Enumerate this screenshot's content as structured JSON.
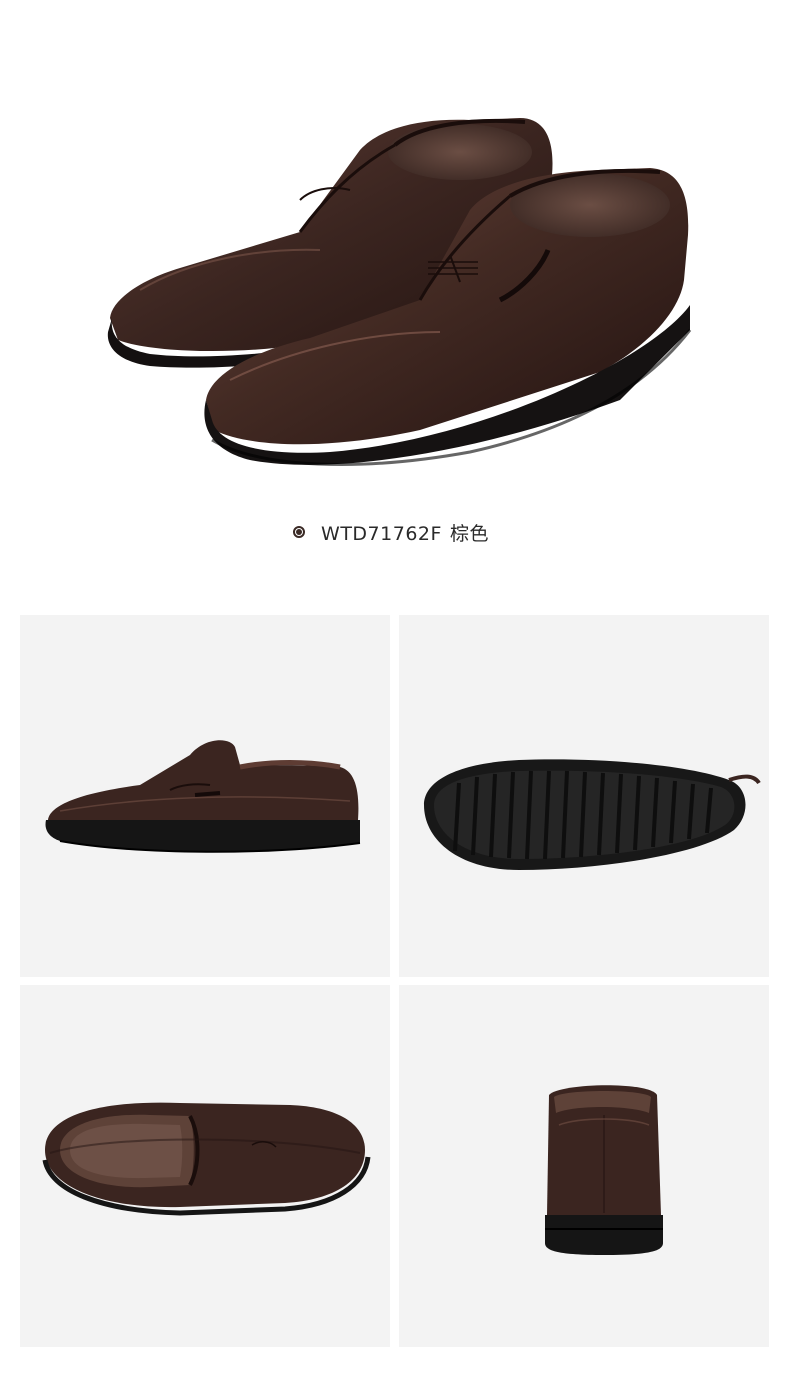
{
  "hero": {
    "subject": "shoe-pair-angled-icon"
  },
  "variant": {
    "code": "WTD71762F",
    "color_name": "棕色",
    "swatch_color": "#3a2a25"
  },
  "gallery": {
    "panels": [
      {
        "view": "side-view-icon"
      },
      {
        "view": "sole-view-icon"
      },
      {
        "view": "top-view-icon"
      },
      {
        "view": "rear-view-icon"
      }
    ],
    "background": "#f3f3f3",
    "leather_color": "#3b2520",
    "sole_color": "#151515"
  }
}
